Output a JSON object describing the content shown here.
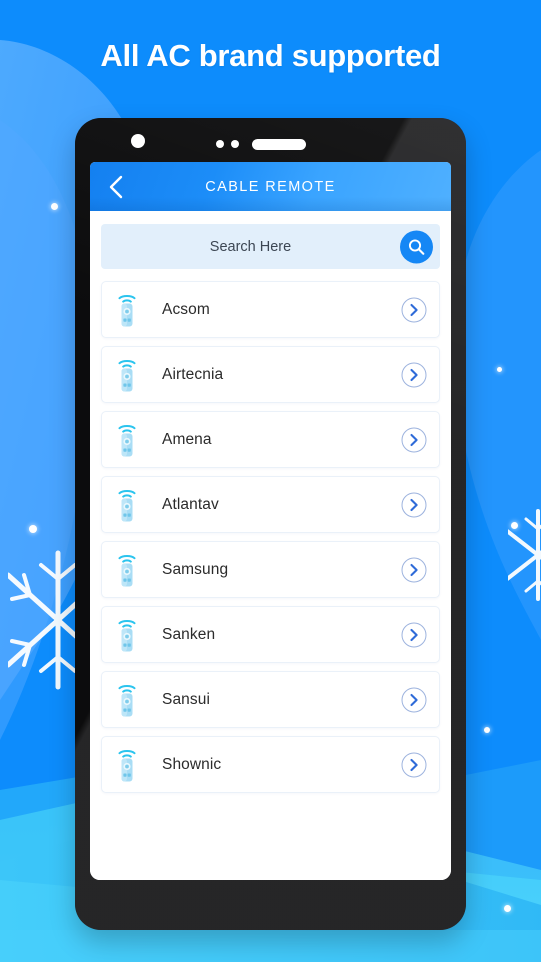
{
  "headline": "All AC brand supported",
  "colors": {
    "background_blue": "#0D8CFC",
    "background_blue_light": "#4FA9FF",
    "background_cyan": "#45CEFA",
    "header_gradient_start": "#1480F0",
    "header_gradient_end": "#4FB0FF",
    "search_field_bg": "#E2EFFB",
    "search_button": "#1587F5",
    "remote_icon_body": "#A9DDF5",
    "remote_icon_wifi": "#2BC4EE",
    "chevron_blue": "#2F6BD8",
    "phone_bezel": "#1B1B1C",
    "card_border": "#EAF1F9",
    "text_dark": "#2B2B2B"
  },
  "phone": {
    "camera_icon": "camera-dot",
    "sensor_icon": "sensor-dot",
    "speaker_icon": "speaker-bar"
  },
  "app": {
    "header": {
      "title": "CABLE REMOTE",
      "back_icon": "chevron-left-icon"
    },
    "search": {
      "placeholder": "Search Here",
      "value": "",
      "button_icon": "search-icon"
    },
    "list": {
      "item_icon": "remote-control-icon",
      "item_action_icon": "chevron-right-icon",
      "items": [
        {
          "name": "Acsom"
        },
        {
          "name": "Airtecnia"
        },
        {
          "name": "Amena"
        },
        {
          "name": "Atlantav"
        },
        {
          "name": "Samsung"
        },
        {
          "name": "Sanken"
        },
        {
          "name": "Sansui"
        },
        {
          "name": "Shownic"
        }
      ]
    }
  },
  "decorations": {
    "snowflake_left": "snowflake-icon",
    "snowflake_right": "snowflake-icon",
    "dots": [
      "dot-1",
      "dot-2",
      "dot-3",
      "dot-4",
      "dot-5",
      "dot-6"
    ]
  }
}
